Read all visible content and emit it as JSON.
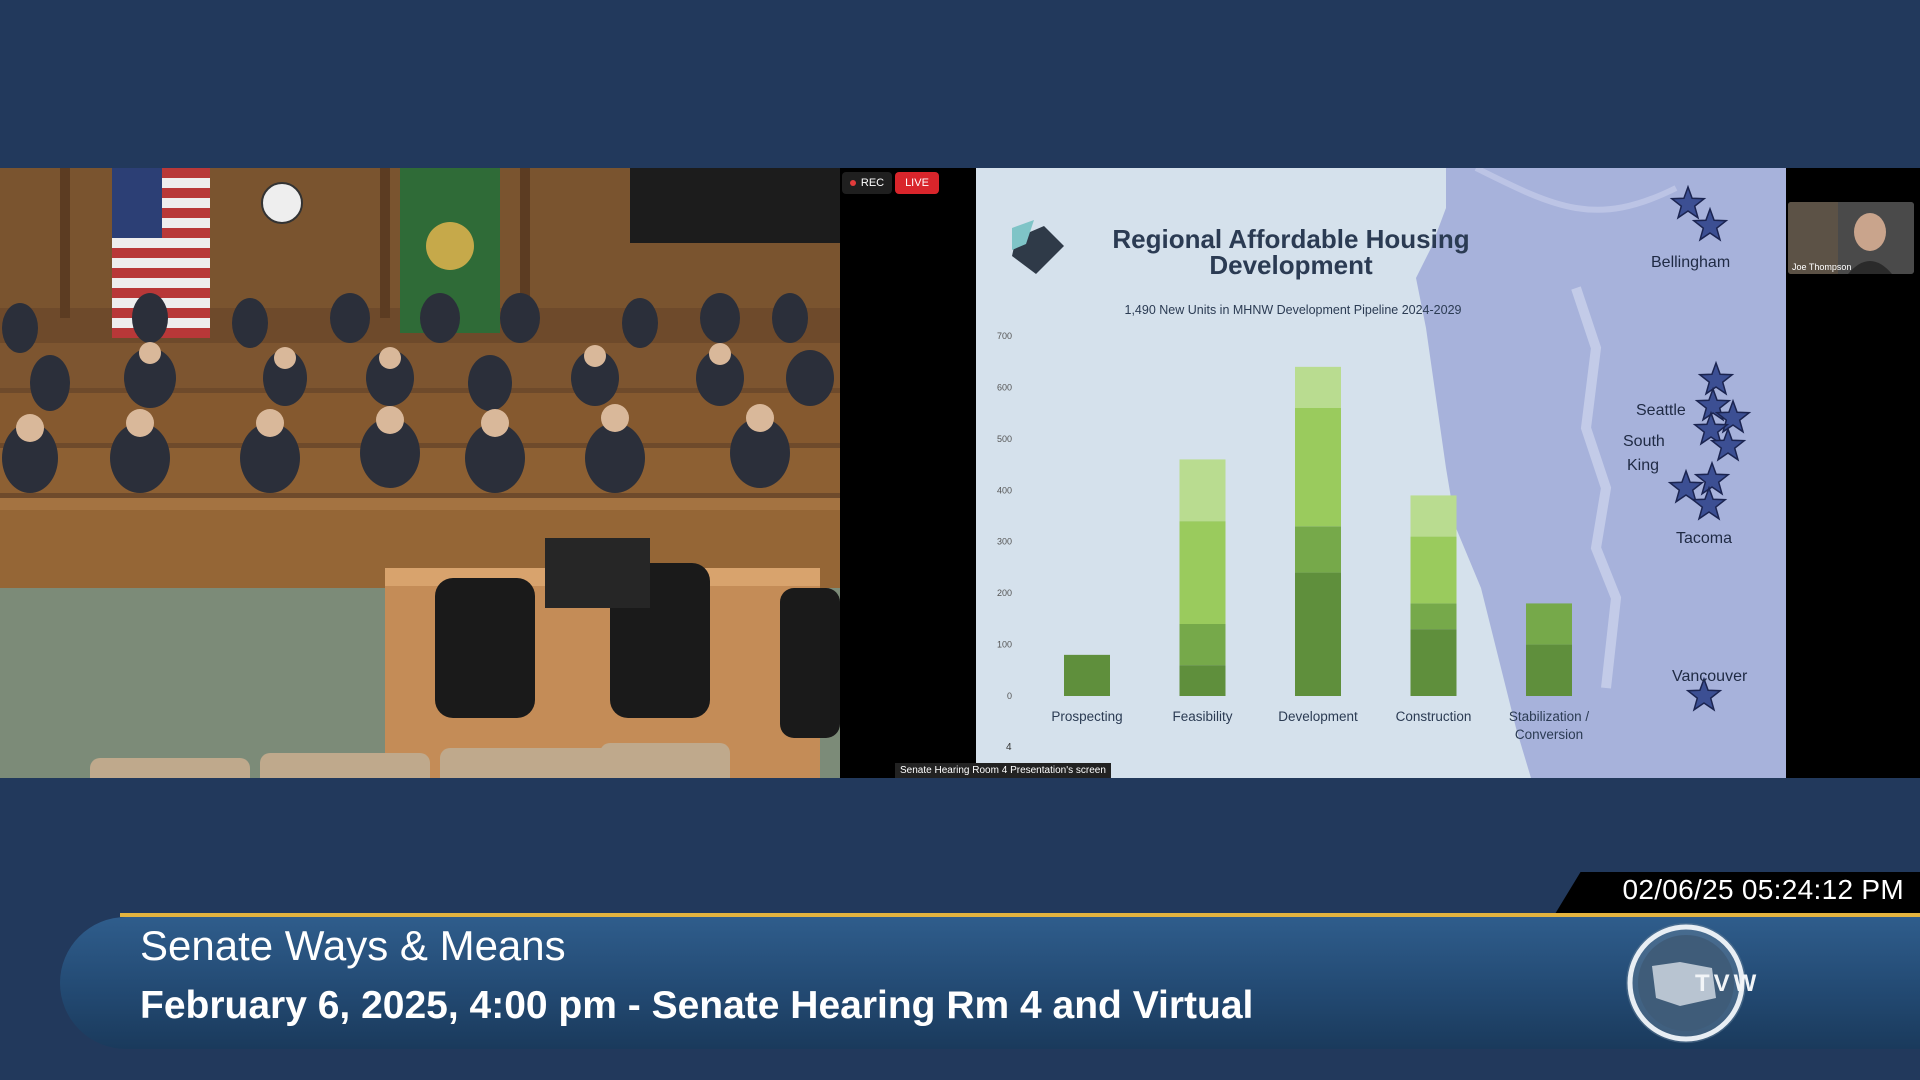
{
  "recording": {
    "rec_label": "REC",
    "live_label": "LIVE"
  },
  "slide": {
    "title_line1": "Regional Affordable Housing",
    "title_line2": "Development",
    "subtitle": "1,490 New Units in MHNW Development Pipeline 2024-2029",
    "page_number": "4",
    "cities": [
      "Bellingham",
      "Seattle",
      "South",
      "King",
      "Tacoma",
      "Vancouver"
    ]
  },
  "chart_data": {
    "type": "bar",
    "stacked": true,
    "title": "1,490 New Units in MHNW Development Pipeline 2024-2029",
    "categories": [
      "Prospecting",
      "Feasibility",
      "Development",
      "Construction",
      "Stabilization / Conversion"
    ],
    "yticks": [
      0,
      100,
      200,
      300,
      400,
      500,
      600,
      700
    ],
    "ylim": [
      0,
      700
    ],
    "grid": false,
    "series_colors": [
      "#5f8f3c",
      "#76a94a",
      "#9acb5d",
      "#b9dc90"
    ],
    "stacks": [
      [
        80
      ],
      [
        60,
        80,
        200,
        120
      ],
      [
        240,
        90,
        230,
        80
      ],
      [
        130,
        50,
        130,
        80
      ],
      [
        100,
        80
      ]
    ]
  },
  "share": {
    "caption": "Senate Hearing Room 4 Presentation's screen",
    "participant_name": "Joe Thompson"
  },
  "broadcast": {
    "timestamp": "02/06/25 05:24:12 PM",
    "program_title": "Senate Ways & Means",
    "program_subtitle": "February 6, 2025, 4:00 pm - Senate Hearing Rm 4 and Virtual",
    "logo_text": "TVW"
  }
}
